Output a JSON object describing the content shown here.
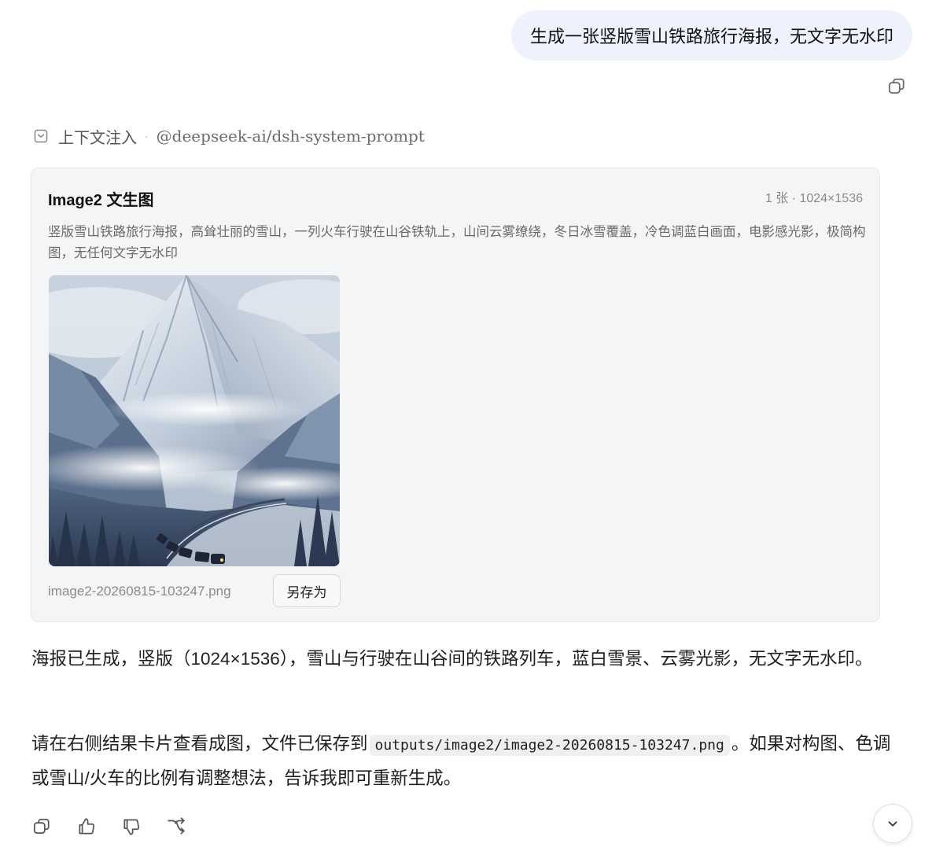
{
  "user_message": {
    "text": "生成一张竖版雪山铁路旅行海报，无文字无水印"
  },
  "context": {
    "label": "上下文注入",
    "separator": "·",
    "source": "@deepseek-ai/dsh-system-prompt"
  },
  "result_card": {
    "title": "Image2 文生图",
    "meta": "1 张 · 1024×1536",
    "prompt": "竖版雪山铁路旅行海报，高耸壮丽的雪山，一列火车行驶在山谷铁轨上，山间云雾缭绕，冬日冰雪覆盖，冷色调蓝白画面，电影感光影，极简构图，无任何文字无水印",
    "file_name": "image2-20260815-103247.png",
    "save_label": "另存为"
  },
  "assistant_reply": {
    "paragraph1": "海报已生成，竖版（1024×1536），雪山与行驶在山谷间的铁路列车，蓝白雪景、云雾光影，无文字无水印。",
    "paragraph2_before": "请在右侧结果卡片查看成图，文件已保存到",
    "paragraph2_code": "outputs/image2/image2-20260815-103247.png",
    "paragraph2_after": "。如果对构图、色调或雪山/火车的比例有调整想法，告诉我即可重新生成。"
  },
  "actions": {
    "icons": [
      "copy-icon",
      "thumbs-up-icon",
      "thumbs-down-icon",
      "branch-icon"
    ]
  },
  "colors": {
    "user_bubble": "#eef2fc",
    "card_bg": "#f4f5f7",
    "code_bg": "#eeeff1"
  }
}
